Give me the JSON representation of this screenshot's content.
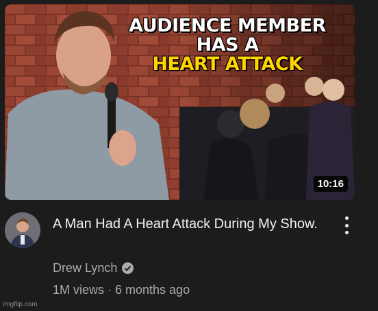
{
  "thumbnail": {
    "title_line1": "AUDIENCE MEMBER",
    "title_line2": "HAS A",
    "title_line3": "HEART ATTACK",
    "duration": "10:16",
    "colors": {
      "highlight": "#ffd400",
      "brick": "#8a3a2c"
    }
  },
  "video": {
    "title": "A Man Had A Heart Attack During My Show.",
    "channel": "Drew Lynch",
    "channel_verified_icon": "check-circle-icon",
    "stats": "1M views · 6 months ago",
    "menu_icon": "vertical-dots-icon"
  },
  "watermark": "imgflip.com"
}
